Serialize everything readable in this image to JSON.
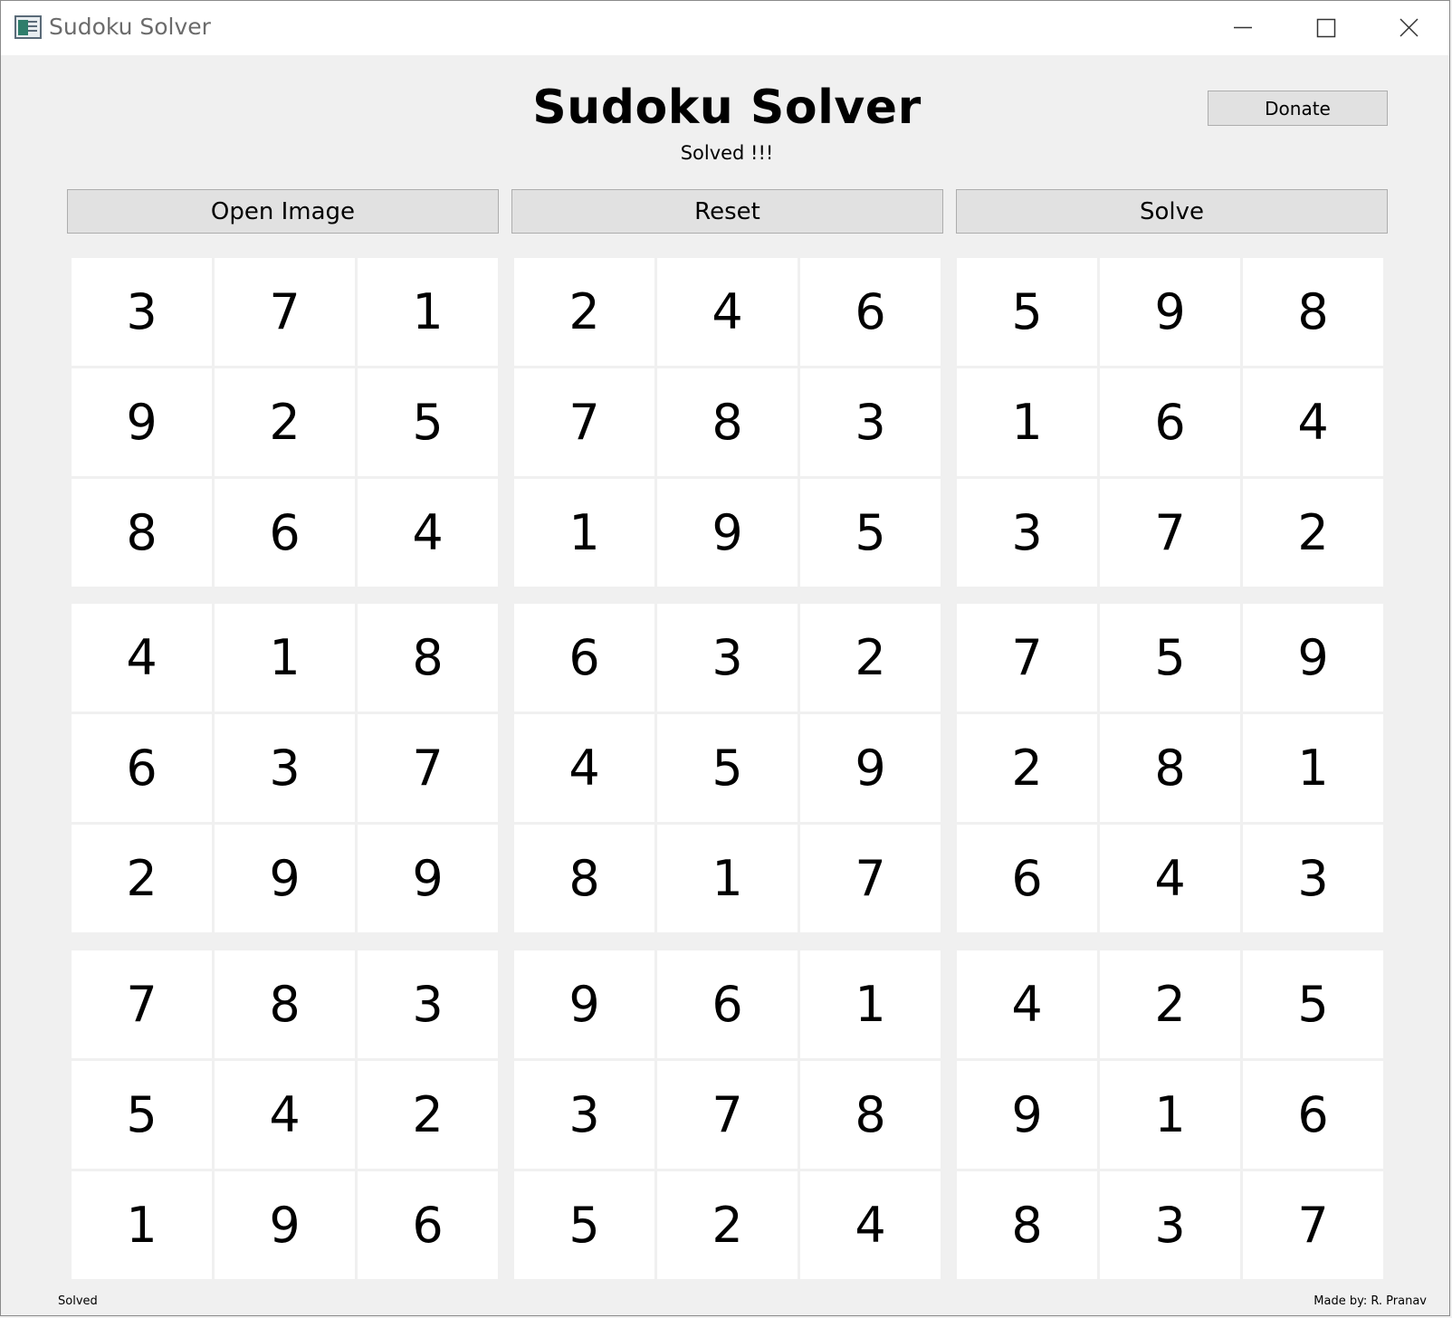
{
  "window": {
    "title": "Sudoku Solver"
  },
  "header": {
    "title": "Sudoku Solver",
    "status": "Solved !!!",
    "donate_label": "Donate"
  },
  "toolbar": {
    "open_label": "Open Image",
    "reset_label": "Reset",
    "solve_label": "Solve"
  },
  "board": {
    "rows": [
      [
        "3",
        "7",
        "1",
        "2",
        "4",
        "6",
        "5",
        "9",
        "8"
      ],
      [
        "9",
        "2",
        "5",
        "7",
        "8",
        "3",
        "1",
        "6",
        "4"
      ],
      [
        "8",
        "6",
        "4",
        "1",
        "9",
        "5",
        "3",
        "7",
        "2"
      ],
      [
        "4",
        "1",
        "8",
        "6",
        "3",
        "2",
        "7",
        "5",
        "9"
      ],
      [
        "6",
        "3",
        "7",
        "4",
        "5",
        "9",
        "2",
        "8",
        "1"
      ],
      [
        "2",
        "9",
        "9",
        "8",
        "1",
        "7",
        "6",
        "4",
        "3"
      ],
      [
        "7",
        "8",
        "3",
        "9",
        "6",
        "1",
        "4",
        "2",
        "5"
      ],
      [
        "5",
        "4",
        "2",
        "3",
        "7",
        "8",
        "9",
        "1",
        "6"
      ],
      [
        "1",
        "9",
        "6",
        "5",
        "2",
        "4",
        "8",
        "3",
        "7"
      ]
    ]
  },
  "footer": {
    "status": "Solved",
    "credit": "Made by: R. Pranav"
  }
}
